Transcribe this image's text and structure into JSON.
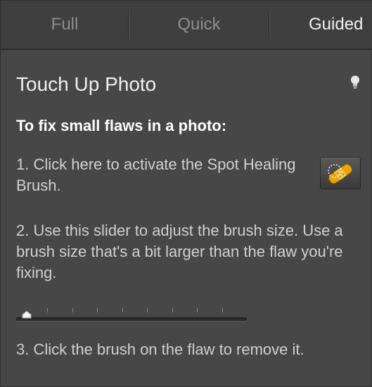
{
  "tabs": [
    {
      "label": "Full",
      "active": false
    },
    {
      "label": "Quick",
      "active": false
    },
    {
      "label": "Guided",
      "active": true
    }
  ],
  "panel": {
    "title": "Touch Up Photo",
    "heading": "To fix small flaws in a photo:",
    "step1": "1. Click here to activate the Spot Healing Brush.",
    "step2": "2. Use this slider to adjust the brush size. Use a brush size that's a bit larger than the flaw you're fixing.",
    "step3": "3. Click the brush on the flaw to remove it."
  },
  "slider": {
    "value_fraction": 0.03,
    "tick_count": 9
  },
  "icons": {
    "tip": "lightbulb-icon",
    "tool": "spot-healing-brush-icon",
    "accent": "#e8a400"
  }
}
